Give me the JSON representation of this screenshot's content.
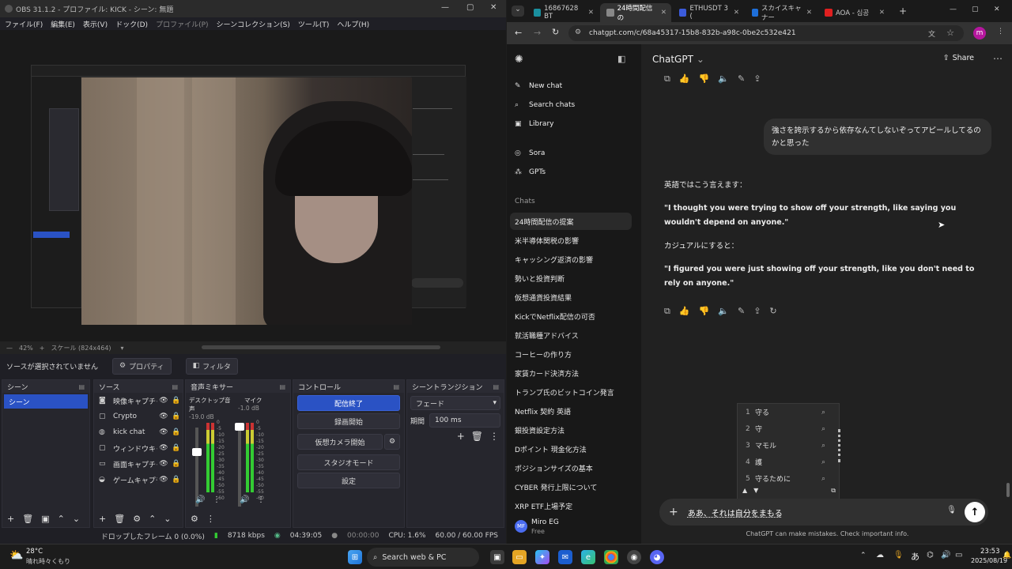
{
  "obs": {
    "title": "OBS 31.1.2 - プロファイル: KICK - シーン: 無題",
    "menu": [
      "ファイル(F)",
      "編集(E)",
      "表示(V)",
      "ドック(D)",
      "プロファイル(P)",
      "シーンコレクション(S)",
      "ツール(T)",
      "ヘルプ(H)"
    ],
    "zoom": "42%",
    "scale_label": "スケール (824x464)",
    "no_source": "ソースが選択されていません",
    "properties_btn": "プロパティ",
    "filters_btn": "フィルタ",
    "docks": {
      "scenes": {
        "title": "シーン",
        "items": [
          "シーン"
        ]
      },
      "sources": {
        "title": "ソース",
        "items": [
          {
            "icon": "camera-icon",
            "glyph": "◙",
            "name": "映像キャプチャデバイス"
          },
          {
            "icon": "window-icon",
            "glyph": "▢",
            "name": "Crypto"
          },
          {
            "icon": "browser-icon",
            "glyph": "◍",
            "name": "kick chat"
          },
          {
            "icon": "window-icon",
            "glyph": "▢",
            "name": "ウィンドウキャプチャ"
          },
          {
            "icon": "monitor-icon",
            "glyph": "▭",
            "name": "画面キャプチャ"
          },
          {
            "icon": "gamepad-icon",
            "glyph": "◒",
            "name": "ゲームキャプチャ"
          }
        ]
      },
      "mixer": {
        "title": "音声ミキサー",
        "channels": [
          {
            "name": "デスクトップ音声",
            "db": "-19.0 dB"
          },
          {
            "name": "マイク",
            "db": "-1.0 dB"
          }
        ],
        "ticks": [
          "0",
          "-5",
          "-10",
          "-15",
          "-20",
          "-25",
          "-30",
          "-35",
          "-40",
          "-45",
          "-50",
          "-55",
          "-60"
        ]
      },
      "controls": {
        "title": "コントロール",
        "buttons": [
          "配信終了",
          "録画開始",
          "仮想カメラ開始",
          "スタジオモード",
          "設定"
        ]
      },
      "transitions": {
        "title": "シーントランジション",
        "type": "フェード",
        "duration_label": "期間",
        "duration": "100 ms"
      }
    },
    "status": {
      "dropped": "ドロップしたフレーム 0 (0.0%)",
      "bitrate": "8718 kbps",
      "stream_time": "04:39:05",
      "rec_time": "00:00:00",
      "cpu": "CPU: 1.6%",
      "fps": "60.00 / 60.00 FPS"
    }
  },
  "browser": {
    "tabs": [
      {
        "label": "16867628 BT",
        "color": "#1a8f9e",
        "active": false
      },
      {
        "label": "24時間配信の",
        "color": "#888888",
        "active": true
      },
      {
        "label": "ETHUSDT 3 (",
        "color": "#3b5bdb",
        "active": false
      },
      {
        "label": "スカイスキャナー",
        "color": "#1e6fd9",
        "active": false
      },
      {
        "label": "AOA - 심공",
        "color": "#e02020",
        "active": false
      }
    ],
    "url": "chatgpt.com/c/68a45317-15b8-832b-a98c-0be2c532e421",
    "profile_initial": "m"
  },
  "chatgpt": {
    "app_title": "ChatGPT",
    "share": "Share",
    "nav": [
      {
        "icon": "new-chat-icon",
        "glyph": "✎",
        "label": "New chat"
      },
      {
        "icon": "search-icon",
        "glyph": "⌕",
        "label": "Search chats"
      },
      {
        "icon": "library-icon",
        "glyph": "▣",
        "label": "Library"
      },
      {
        "icon": "sora-icon",
        "glyph": "◎",
        "label": "Sora"
      },
      {
        "icon": "gpts-icon",
        "glyph": "⁂",
        "label": "GPTs"
      }
    ],
    "chats_heading": "Chats",
    "chats": [
      "24時間配信の提案",
      "米半導体関税の影響",
      "キャッシング返済の影響",
      "勢いと投資判断",
      "仮想通貨投資結果",
      "KickでNetflix配信の可否",
      "就活職種アドバイス",
      "コーヒーの作り方",
      "家賃カード決済方法",
      "トランプ氏のビットコイン発言",
      "Netflix 契約 英語",
      "銀投資設定方法",
      "Dポイント 現金化方法",
      "ポジションサイズの基本",
      "CYBER 発行上限について",
      "XRP ETF上場予定"
    ],
    "user_name": "Miro EG",
    "user_plan": "Free",
    "user_initials": "MF",
    "user_message": "強さを誇示するから依存なんてしないぞってアピールしてるのかと思った",
    "assistant": {
      "intro": "英語ではこう言えます：",
      "quote1": "\"I thought you were trying to show off your strength, like saying you wouldn't depend on anyone.\"",
      "casual": "カジュアルにすると：",
      "quote2": "\"I figured you were just showing off your strength, like you don't need to rely on anyone.\""
    },
    "ime_candidates": [
      "守る",
      "守",
      "マモル",
      "護",
      "守るために"
    ],
    "input_text": "ああ、それは自分をまもる",
    "disclaimer": "ChatGPT can make mistakes. Check important info."
  },
  "taskbar": {
    "weather_temp": "28°C",
    "weather_desc": "晴れ時々くもり",
    "search_placeholder": "Search web & PC",
    "time": "23:53",
    "date": "2025/08/19",
    "ime_indicator": "あ"
  }
}
